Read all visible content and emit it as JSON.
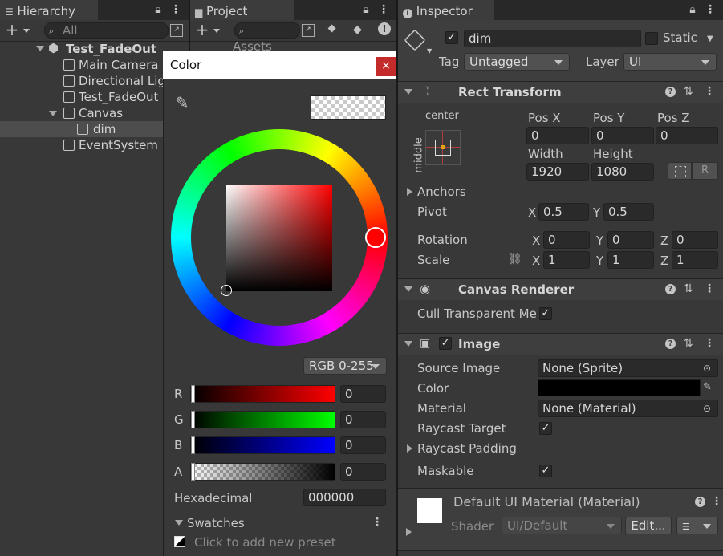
{
  "hierarchy": {
    "tab_label": "Hierarchy",
    "search_placeholder": "All",
    "scene": "Test_FadeOut",
    "items": [
      "Main Camera",
      "Directional Light",
      "Test_FadeOut",
      "Canvas",
      "dim",
      "EventSystem"
    ]
  },
  "project": {
    "tab_label": "Project",
    "partial_text": "Assets"
  },
  "color_picker": {
    "title": "Color",
    "mode": "RGB 0-255",
    "channels": [
      {
        "label": "R",
        "value": "0"
      },
      {
        "label": "G",
        "value": "0"
      },
      {
        "label": "B",
        "value": "0"
      },
      {
        "label": "A",
        "value": "0"
      }
    ],
    "hex_label": "Hexadecimal",
    "hex_value": "000000",
    "swatches_label": "Swatches",
    "add_preset": "Click to add new preset",
    "colors": {
      "red": "#ff0000",
      "green": "#00ff00",
      "blue": "#0000ff"
    }
  },
  "inspector": {
    "tab_label": "Inspector",
    "object_name": "dim",
    "static_label": "Static",
    "tag_label": "Tag",
    "tag_value": "Untagged",
    "layer_label": "Layer",
    "layer_value": "UI",
    "rect_transform": {
      "title": "Rect Transform",
      "anchor_h": "center",
      "anchor_v": "middle",
      "pos_x_label": "Pos X",
      "pos_x": "0",
      "pos_y_label": "Pos Y",
      "pos_y": "0",
      "pos_z_label": "Pos Z",
      "pos_z": "0",
      "width_label": "Width",
      "width": "1920",
      "height_label": "Height",
      "height": "1080",
      "anchors_label": "Anchors",
      "pivot_label": "Pivot",
      "pivot_x": "0.5",
      "pivot_y": "0.5",
      "rotation_label": "Rotation",
      "rot_x": "0",
      "rot_y": "0",
      "rot_z": "0",
      "scale_label": "Scale",
      "scale_x": "1",
      "scale_y": "1",
      "scale_z": "1",
      "axis_x": "X",
      "axis_y": "Y",
      "axis_z": "Z",
      "r_button": "R"
    },
    "canvas_renderer": {
      "title": "Canvas Renderer",
      "cull_label": "Cull Transparent Mesh"
    },
    "image": {
      "title": "Image",
      "source_label": "Source Image",
      "source_value": "None (Sprite)",
      "color_label": "Color",
      "material_label": "Material",
      "material_value": "None (Material)",
      "raycast_target_label": "Raycast Target",
      "raycast_padding_label": "Raycast Padding",
      "maskable_label": "Maskable"
    },
    "material": {
      "title": "Default UI Material (Material)",
      "shader_label": "Shader",
      "shader_value": "UI/Default",
      "edit_button": "Edit..."
    }
  }
}
